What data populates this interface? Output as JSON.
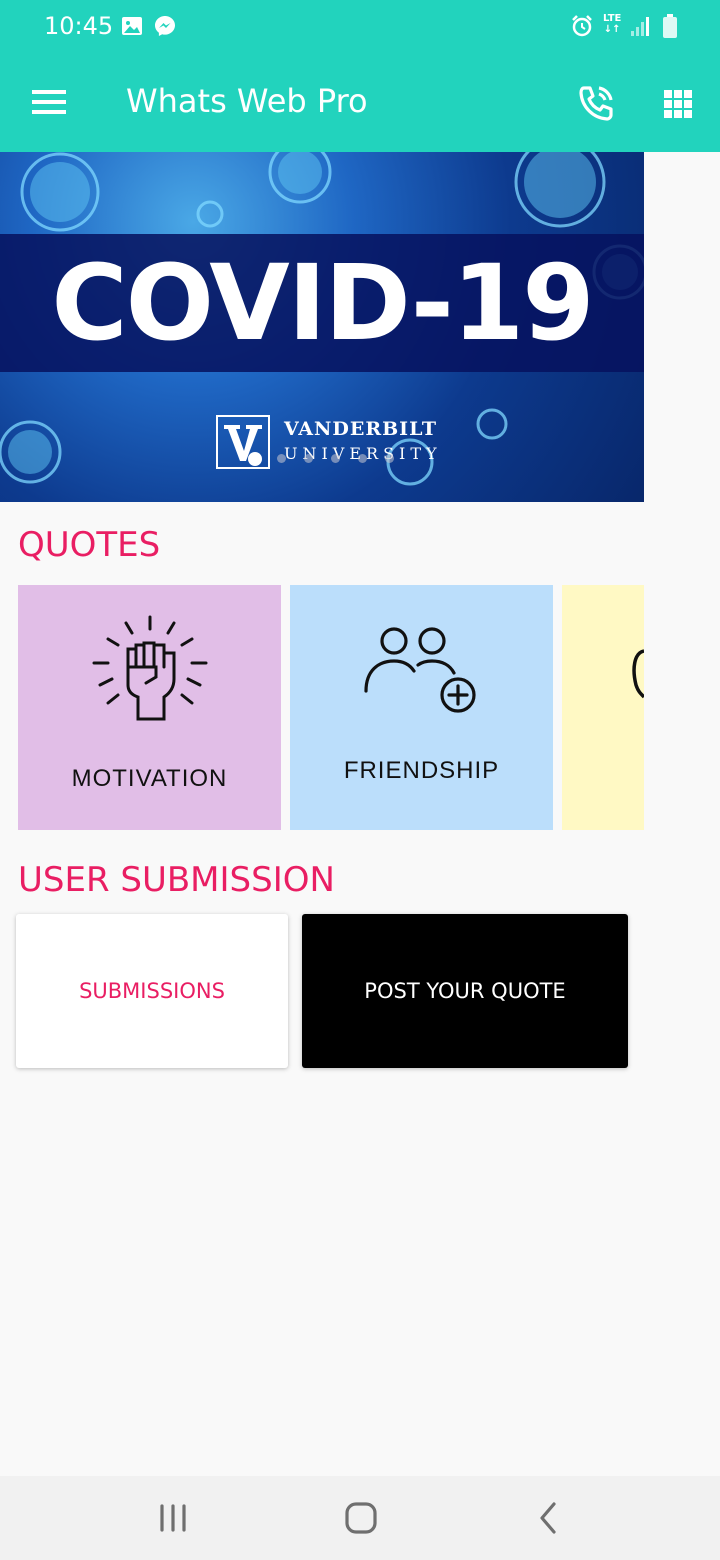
{
  "status_bar": {
    "time": "10:45",
    "network": "LTE",
    "icons": [
      "image-icon",
      "messenger-icon",
      "alarm-icon",
      "lte-icon",
      "signal-icon",
      "battery-icon"
    ]
  },
  "app_bar": {
    "title": "Whats Web Pro",
    "background": "#22d3bd",
    "icons": [
      "menu-icon",
      "phone-call-icon",
      "grid-icon"
    ]
  },
  "banner": {
    "title": "COVID-19",
    "logo_line1": "VANDERBILT",
    "logo_line2": "UNIVERSITY",
    "slide_count": 6,
    "active_slide": 1
  },
  "quotes": {
    "heading": "QUOTES",
    "categories": [
      {
        "label": "MOTIVATION",
        "color": "#e1bee7",
        "icon": "raised-fist-icon"
      },
      {
        "label": "FRIENDSHIP",
        "color": "#bbdefb",
        "icon": "add-friend-icon"
      },
      {
        "label": "",
        "color": "#fff9c4",
        "icon": "partial-circle-icon"
      }
    ]
  },
  "user_submission": {
    "heading": "USER SUBMISSION",
    "submissions_label": "SUBMISSIONS",
    "post_label": "POST YOUR QUOTE"
  },
  "nav_bar": {
    "buttons": [
      "recent-apps-icon",
      "home-icon",
      "back-icon"
    ]
  },
  "accent": "#e91e63"
}
